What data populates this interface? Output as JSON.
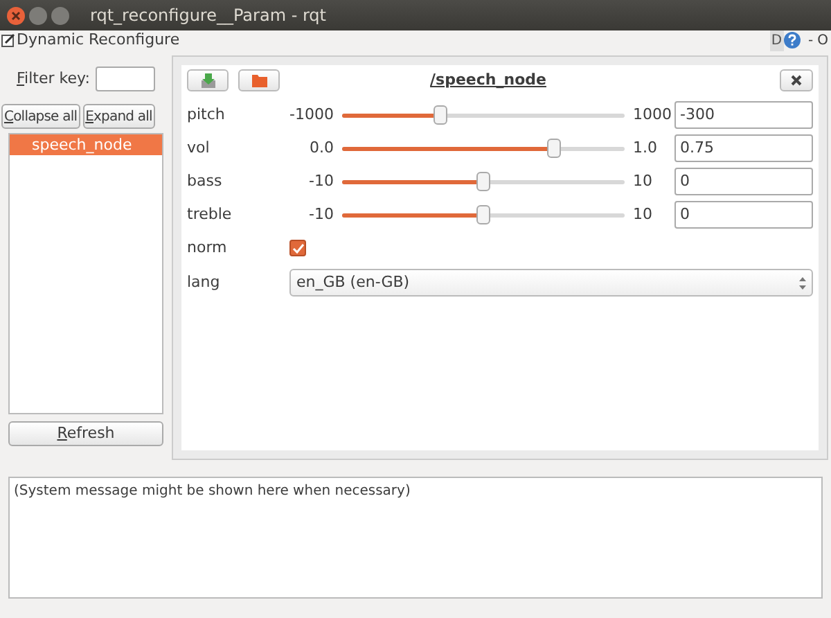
{
  "window": {
    "title": "rqt_reconfigure__Param - rqt"
  },
  "plugin": {
    "title": "Dynamic Reconfigure",
    "dock_buttons": [
      "D",
      "-",
      "O"
    ]
  },
  "sidebar": {
    "filter_label": "Filter key:",
    "collapse_button": "Collapse all",
    "expand_button": "Expand all",
    "nodes": [
      {
        "label": "speech_node",
        "selected": true
      }
    ],
    "refresh_button": "Refresh"
  },
  "node_panel": {
    "title": "/speech_node",
    "params": [
      {
        "kind": "slider",
        "name": "pitch",
        "min": "-1000",
        "max": "1000",
        "level": 0.35,
        "value": "-300"
      },
      {
        "kind": "slider",
        "name": "vol",
        "min": "0.0",
        "max": "1.0",
        "level": 0.75,
        "value": "0.75"
      },
      {
        "kind": "slider",
        "name": "bass",
        "min": "-10",
        "max": "10",
        "level": 0.5,
        "value": "0"
      },
      {
        "kind": "slider",
        "name": "treble",
        "min": "-10",
        "max": "10",
        "level": 0.5,
        "value": "0"
      },
      {
        "kind": "checkbox",
        "name": "norm",
        "checked": true
      },
      {
        "kind": "select",
        "name": "lang",
        "value": "en_GB (en-GB)"
      }
    ]
  },
  "message_box": {
    "text": "(System message might be shown here when necessary)"
  }
}
